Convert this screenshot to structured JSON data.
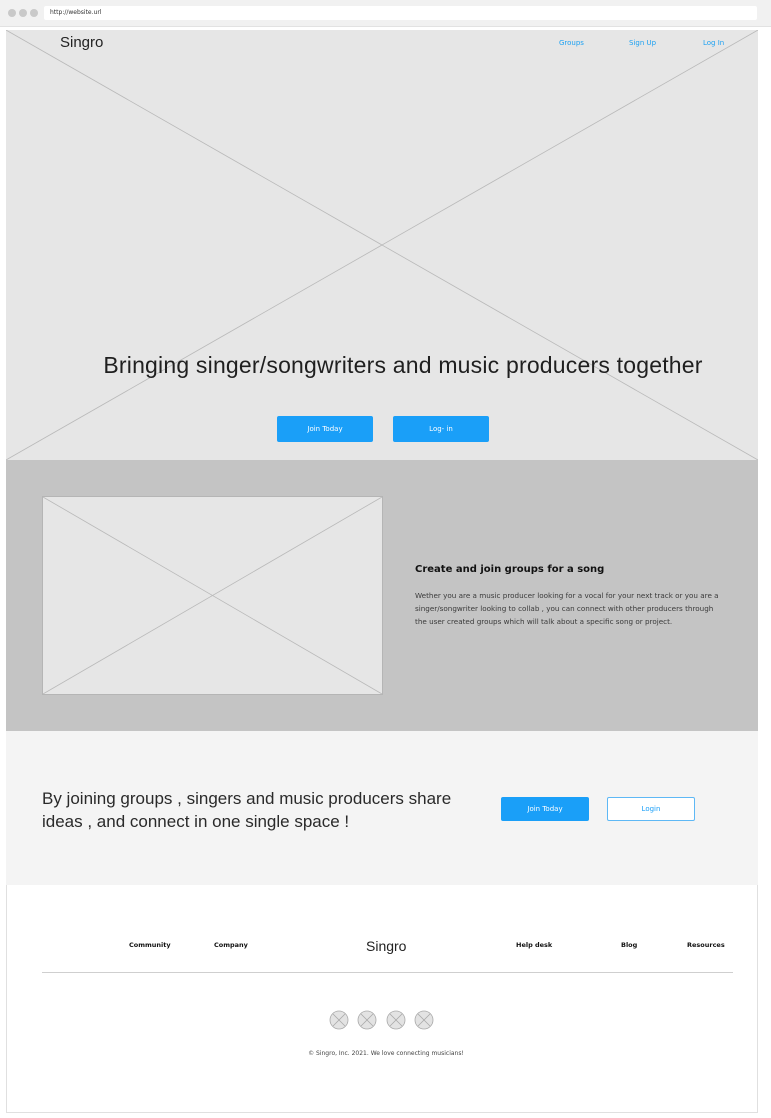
{
  "browser": {
    "url": "http://website.url"
  },
  "header": {
    "brand": "Singro",
    "nav": [
      {
        "label": "Groups"
      },
      {
        "label": "Sign Up"
      },
      {
        "label": "Log In"
      }
    ]
  },
  "hero": {
    "title": "Bringing singer/songwriters and music producers together",
    "join_label": "Join Today",
    "login_label": "Log- in"
  },
  "feature": {
    "title": "Create and join groups for a song",
    "text": "Wether you are a music producer looking for a vocal for your next track or you are a singer/songwriter looking to collab , you can connect with other producers through the user created groups which will talk about a specific song or project."
  },
  "cta": {
    "text": "By joining groups , singers and music producers share ideas , and connect in one single space !",
    "join_label": "Join Today",
    "login_label": "Login"
  },
  "footer": {
    "links": [
      "Community",
      "Company",
      "Help desk",
      "Blog",
      "Resources"
    ],
    "brand": "Singro",
    "copyright": "© Singro, Inc. 2021. We love connecting musicians!"
  },
  "colors": {
    "accent": "#1a9ff8",
    "hero_bg": "#e6e6e6",
    "feature_bg": "#c4c4c4",
    "cta_bg": "#f4f4f4"
  }
}
